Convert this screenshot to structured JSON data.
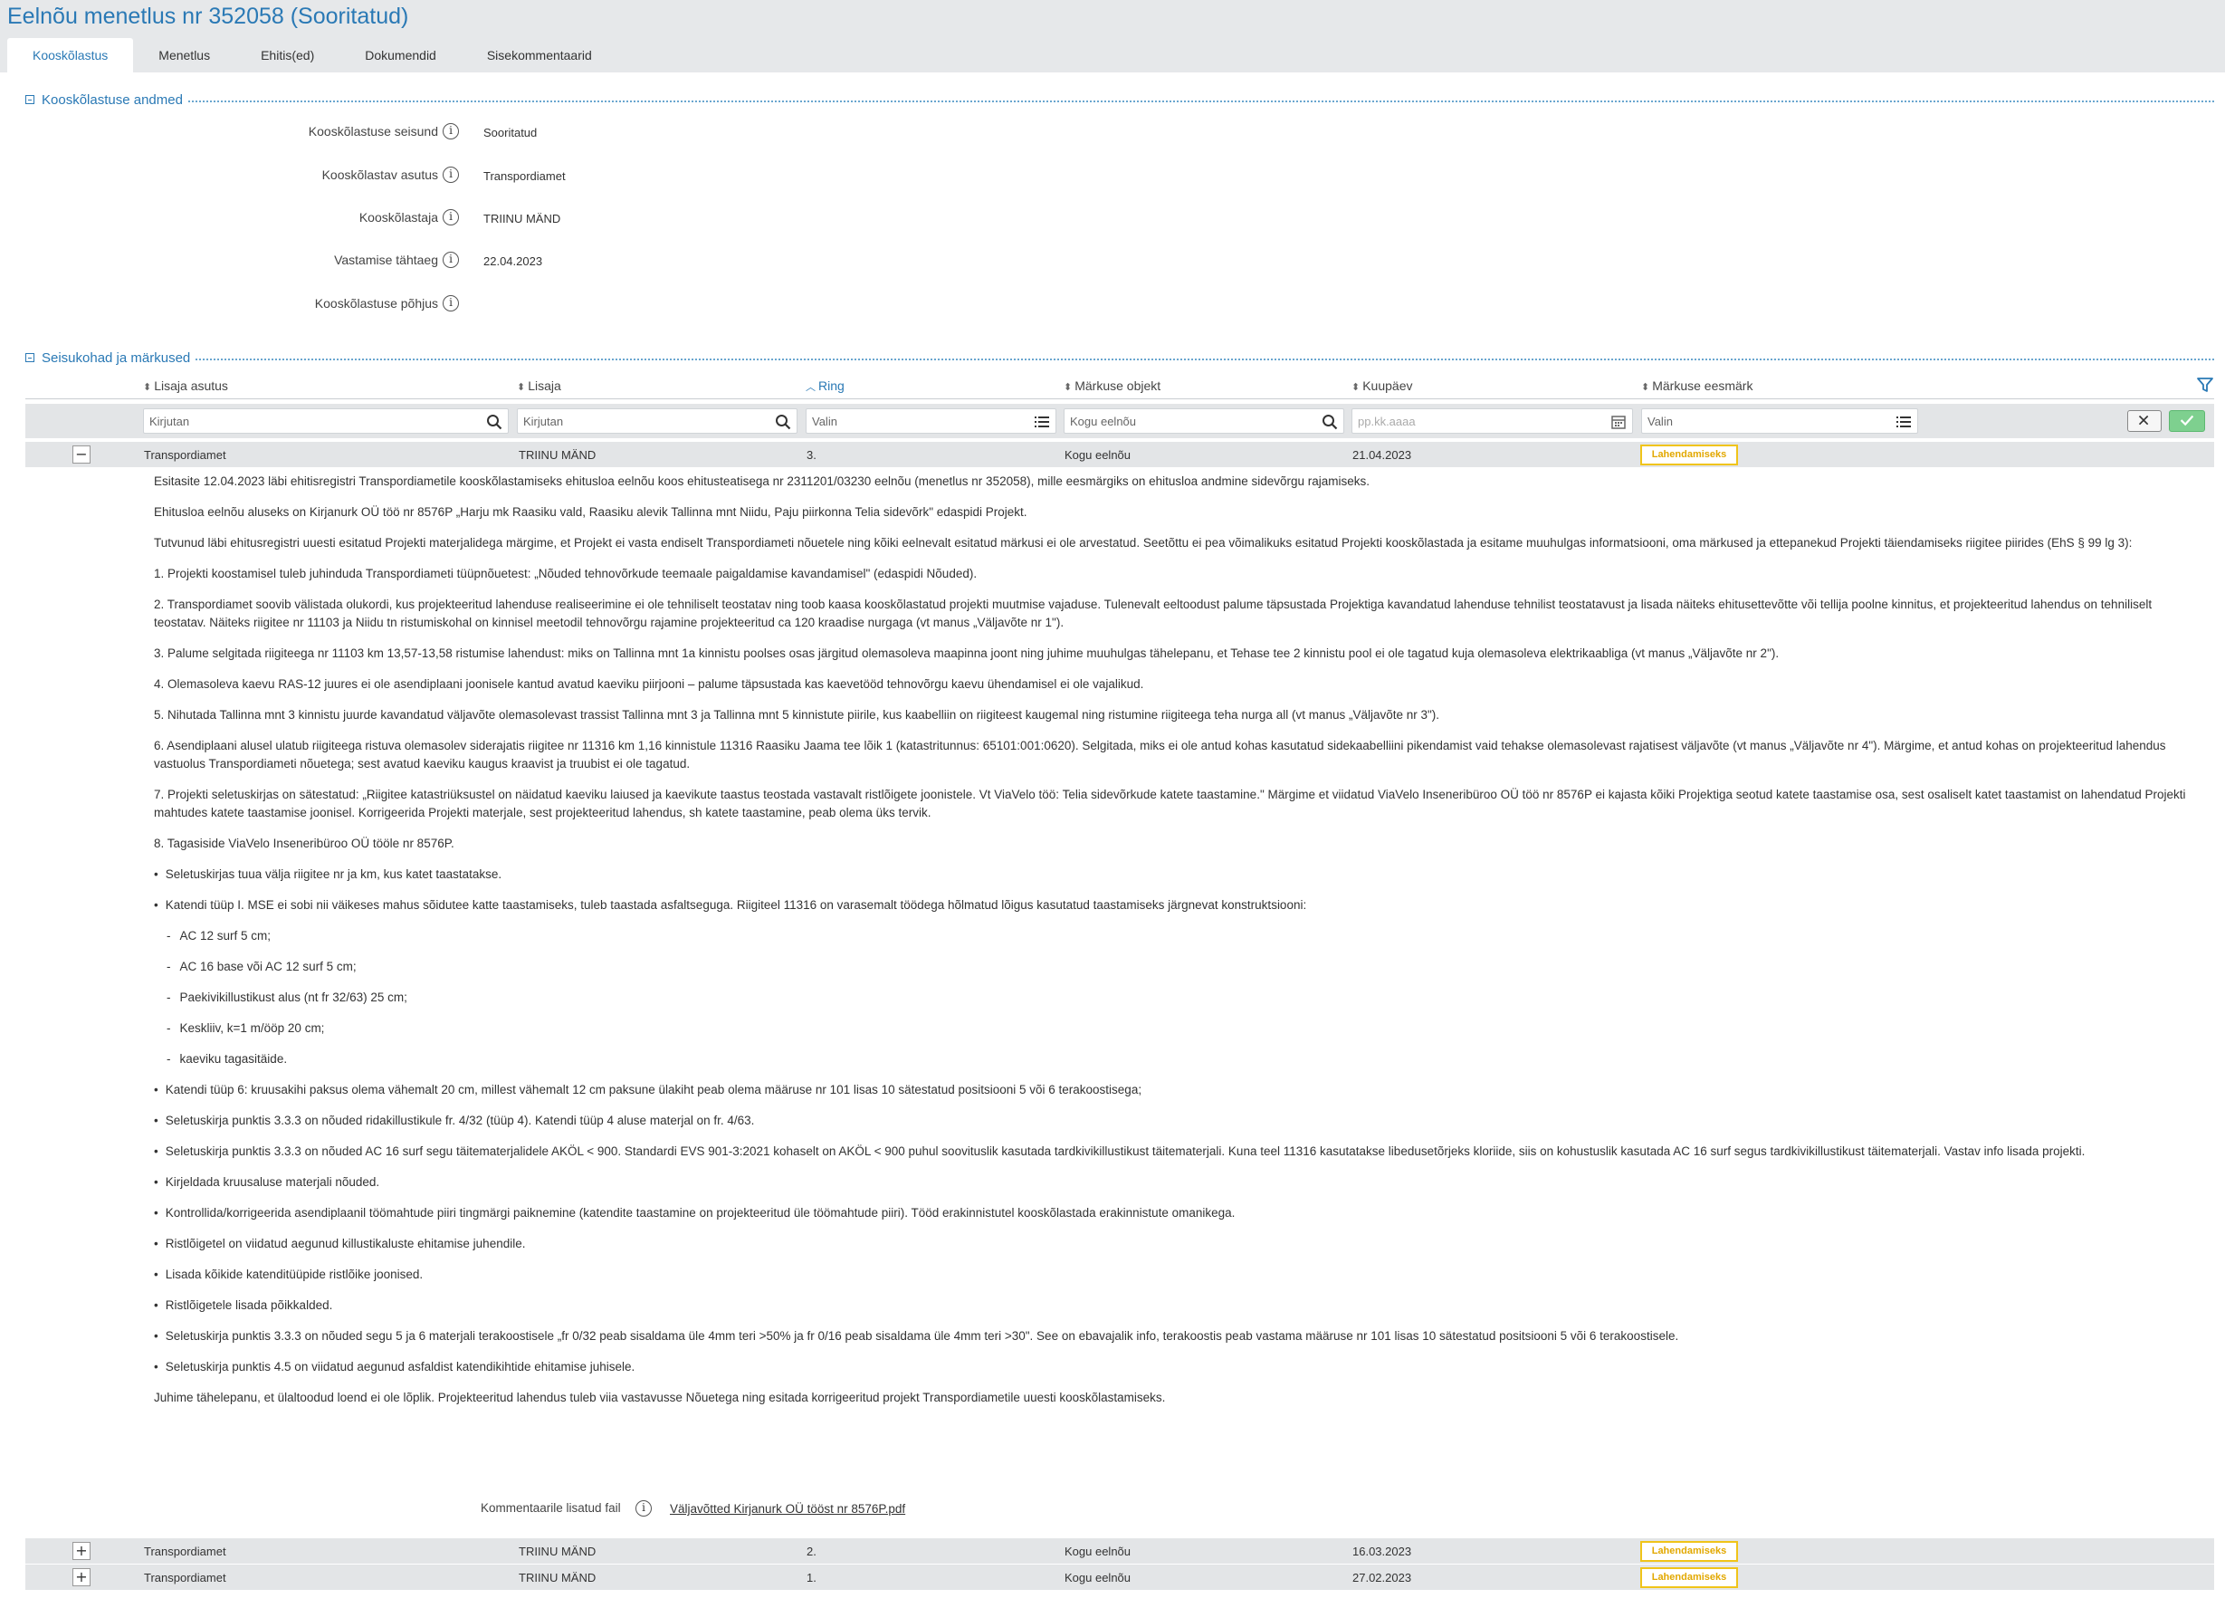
{
  "page": {
    "title": "Eelnõu menetlus nr 352058 (Sooritatud)"
  },
  "tabs": [
    {
      "label": "Kooskõlastus"
    },
    {
      "label": "Menetlus"
    },
    {
      "label": "Ehitis(ed)"
    },
    {
      "label": "Dokumendid"
    },
    {
      "label": "Sisekommentaarid"
    }
  ],
  "details": {
    "section_title": "Kooskõlastuse andmed",
    "fields": [
      {
        "label": "Kooskõlastuse seisund",
        "value": "Sooritatud"
      },
      {
        "label": "Kooskõlastav asutus",
        "value": "Transpordiamet"
      },
      {
        "label": "Kooskõlastaja",
        "value": "TRIINU MÄND"
      },
      {
        "label": "Vastamise tähtaeg",
        "value": "22.04.2023"
      },
      {
        "label": "Kooskõlastuse põhjus",
        "value": ""
      }
    ]
  },
  "comments": {
    "section_title": "Seisukohad ja märkused",
    "columns": [
      {
        "label": "Lisaja asutus"
      },
      {
        "label": "Lisaja"
      },
      {
        "label": "Ring",
        "sorted": true
      },
      {
        "label": "Märkuse objekt"
      },
      {
        "label": "Kuupäev"
      },
      {
        "label": "Märkuse eesmärk"
      }
    ],
    "filters": {
      "agency": "Kirjutan",
      "author": "Kirjutan",
      "round": "Valin",
      "object": "Kogu eelnõu",
      "date": "pp.kk.aaaa",
      "purpose": "Valin"
    },
    "rows": [
      {
        "agency": "Transpordiamet",
        "author": "TRIINU MÄND",
        "round": "3.",
        "object": "Kogu eelnõu",
        "date": "21.04.2023",
        "purpose": "Lahendamiseks",
        "toggle": "−"
      },
      {
        "agency": "Transpordiamet",
        "author": "TRIINU MÄND",
        "round": "2.",
        "object": "Kogu eelnõu",
        "date": "16.03.2023",
        "purpose": "Lahendamiseks",
        "toggle": "+"
      },
      {
        "agency": "Transpordiamet",
        "author": "TRIINU MÄND",
        "round": "1.",
        "object": "Kogu eelnõu",
        "date": "27.02.2023",
        "purpose": "Lahendamiseks",
        "toggle": "+"
      }
    ],
    "expanded": {
      "paragraphs": [
        "Esitasite 12.04.2023 läbi ehitisregistri Transpordiametile kooskõlastamiseks ehitusloa eelnõu koos ehitusteatisega nr 2311201/03230 eelnõu (menetlus nr 352058), mille eesmärgiks on ehitusloa andmine sidevõrgu rajamiseks.",
        "Ehitusloa eelnõu aluseks on Kirjanurk OÜ töö nr 8576P „Harju mk Raasiku vald, Raasiku alevik Tallinna mnt Niidu, Paju piirkonna Telia sidevõrk\" edaspidi Projekt.",
        "Tutvunud läbi ehitusregistri uuesti esitatud Projekti materjalidega märgime, et Projekt ei vasta endiselt Transpordiameti nõuetele ning kõiki eelnevalt esitatud märkusi ei ole arvestatud. Seetõttu ei pea võimalikuks esitatud Projekti kooskõlastada ja esitame muuhulgas informatsiooni, oma märkused ja ettepanekud Projekti täiendamiseks riigitee piirides (EhS § 99 lg 3):",
        "1. Projekti koostamisel tuleb juhinduda Transpordiameti tüüpnõuetest: „Nõuded tehnovõrkude teemaale paigaldamise kavandamisel\" (edaspidi Nõuded).",
        "2. Transpordiamet soovib välistada olukordi, kus projekteeritud lahenduse realiseerimine ei ole tehniliselt teostatav ning toob kaasa kooskõlastatud projekti muutmise vajaduse. Tulenevalt eeltoodust palume täpsustada Projektiga kavandatud lahenduse tehnilist teostatavust ja lisada näiteks ehitusettevõtte või tellija poolne kinnitus, et projekteeritud lahendus on tehniliselt teostatav. Näiteks riigitee nr 11103 ja Niidu tn ristumiskohal on  kinnisel meetodil tehnovõrgu rajamine projekteeritud ca 120 kraadise nurgaga (vt manus „Väljavõte nr 1\").",
        "3. Palume selgitada riigiteega nr 11103 km 13,57-13,58 ristumise lahendust: miks on Tallinna mnt 1a kinnistu poolses osas järgitud olemasoleva maapinna joont ning juhime muuhulgas tähelepanu, et Tehase tee 2 kinnistu pool ei ole tagatud kuja olemasoleva elektrikaabliga (vt manus „Väljavõte nr 2\").",
        "4. Olemasoleva kaevu RAS-12 juures ei ole asendiplaani joonisele kantud avatud kaeviku piirjooni – palume täpsustada kas kaevetööd tehnovõrgu kaevu ühendamisel ei ole vajalikud.",
        "5. Nihutada Tallinna mnt 3 kinnistu juurde kavandatud väljavõte olemasolevast trassist Tallinna mnt 3 ja Tallinna mnt 5 kinnistute piirile, kus kaabelliin on riigiteest kaugemal ning ristumine riigiteega teha nurga all (vt manus „Väljavõte nr 3\").",
        "6. Asendiplaani alusel ulatub riigiteega ristuva olemasolev siderajatis riigitee nr 11316 km 1,16 kinnistule 11316 Raasiku Jaama tee lõik 1 (katastritunnus: 65101:001:0620). Selgitada, miks ei ole antud kohas kasutatud sidekaabelliini pikendamist vaid tehakse olemasolevast rajatisest väljavõte (vt manus „Väljavõte nr 4\"). Märgime, et antud kohas on projekteeritud lahendus vastuolus Transpordiameti nõuetega; sest avatud kaeviku kaugus kraavist ja truubist ei ole tagatud.",
        "7. Projekti seletuskirjas on sätestatud: „Riigitee katastriüksustel on näidatud kaeviku laiused ja kaevikute taastus teostada vastavalt ristlõigete joonistele. Vt ViaVelo töö: Telia sidevõrkude katete taastamine.\" Märgime et viidatud ViaVelo Inseneribüroo OÜ töö nr 8576P ei kajasta kõiki Projektiga seotud katete taastamise osa, sest osaliselt katet taastamist on lahendatud Projekti mahtudes katete taastamise joonisel. Korrigeerida Projekti materjale, sest projekteeritud lahendus, sh katete taastamine, peab olema üks tervik.",
        "8. Tagasiside ViaVelo Inseneribüroo OÜ tööle nr 8576P."
      ],
      "bullets_a": [
        "Seletuskirjas tuua välja riigitee nr ja km, kus katet taastatakse.",
        "Katendi tüüp I. MSE ei sobi nii väikeses mahus sõidutee katte taastamiseks, tuleb taastada asfaltseguga. Riigiteel 11316 on varasemalt töödega hõlmatud lõigus kasutatud taastamiseks järgnevat konstruktsiooni:"
      ],
      "dashes": [
        "AC 12 surf 5 cm;",
        "AC 16 base või AC 12 surf 5 cm;",
        "Paekivikillustikust alus (nt fr 32/63) 25 cm;",
        "Keskliiv, k=1 m/ööp 20 cm;",
        "kaeviku tagasitäide."
      ],
      "bullets_b": [
        "Katendi tüüp 6: kruusakihi paksus olema vähemalt 20 cm, millest vähemalt 12 cm paksune ülakiht peab olema määruse nr 101 lisas 10 sätestatud positsiooni 5 või 6 terakoostisega;",
        "Seletuskirja punktis 3.3.3 on nõuded ridakillustikule fr. 4/32 (tüüp 4). Katendi tüüp 4 aluse materjal on fr. 4/63.",
        "Seletuskirja punktis 3.3.3 on nõuded AC 16 surf segu täitematerjalidele AKÖL < 900. Standardi EVS 901-3:2021 kohaselt on AKÖL < 900 puhul soovituslik kasutada tardkivikillustikust täitematerjali. Kuna teel 11316 kasutatakse libedusetõrjeks kloriide, siis on kohustuslik kasutada AC 16 surf segus tardkivikillustikust täitematerjali. Vastav info lisada projekti.",
        "Kirjeldada kruusaluse materjali nõuded.",
        "Kontrollida/korrigeerida asendiplaanil töömahtude piiri tingmärgi paiknemine (katendite taastamine on projekteeritud üle töömahtude piiri). Tööd erakinnistutel kooskõlastada erakinnistute omanikega.",
        "Ristlõigetel on viidatud aegunud killustikaluste ehitamise juhendile.",
        "Lisada kõikide katenditüüpide ristlõike joonised.",
        "Ristlõigetele lisada põikkalded.",
        "Seletuskirja punktis 3.3.3 on nõuded segu 5 ja 6 materjali terakoostisele „fr 0/32 peab sisaldama üle 4mm teri >50% ja fr 0/16 peab sisaldama üle 4mm teri >30\". See on ebavajalik info, terakoostis peab vastama määruse nr 101 lisas 10 sätestatud positsiooni 5 või 6 terakoostisele.",
        "Seletuskirja punktis 4.5 on viidatud aegunud asfaldist katendikihtide ehitamise juhisele."
      ],
      "closing": "Juhime tähelepanu, et ülaltoodud loend ei ole lõplik. Projekteeritud lahendus tuleb viia vastavusse Nõuetega ning esitada korrigeeritud projekt Transpordiametile uuesti kooskõlastamiseks.",
      "file_label": "Kommentaarile lisatud fail",
      "file_name": "Väljavõtted Kirjanurk OÜ tööst nr 8576P.pdf"
    }
  },
  "colors": {
    "accent": "#2a79b5",
    "badge": "#f0c419",
    "header_bg": "#e6e8ea",
    "row_bg": "#e3e5e7",
    "confirm": "#7ed08f"
  }
}
